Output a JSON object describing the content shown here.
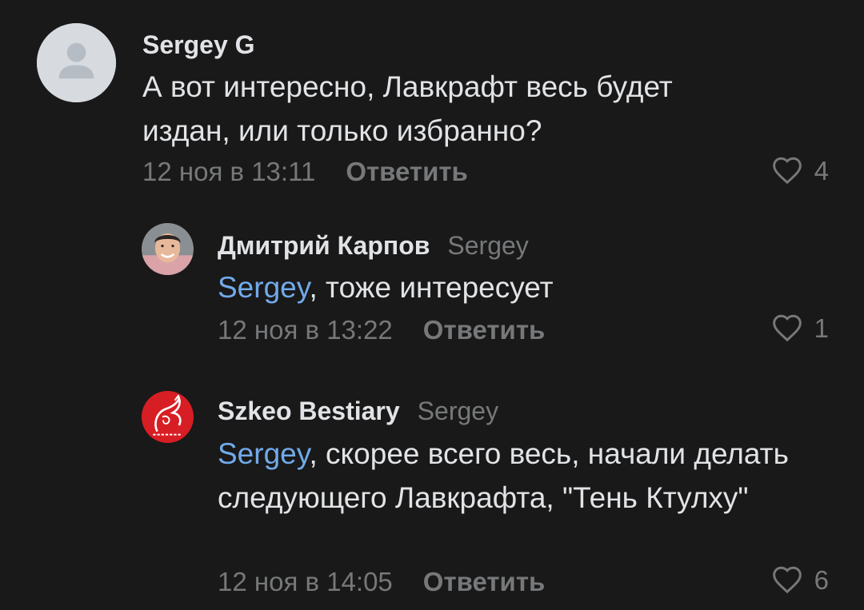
{
  "comments": [
    {
      "author": "Sergey G",
      "reply_to": "",
      "mention": "",
      "text": "А вот интересно, Лавкрафт весь будет издан, или только избранно?",
      "time": "12 ноя в 13:11",
      "reply_label": "Ответить",
      "likes": "4"
    },
    {
      "author": "Дмитрий Карпов",
      "reply_to": "Sergey",
      "mention": "Sergey",
      "text": ", тоже интересует",
      "time": "12 ноя в 13:22",
      "reply_label": "Ответить",
      "likes": "1"
    },
    {
      "author": "Szkeo Bestiary",
      "reply_to": "Sergey",
      "mention": "Sergey",
      "text": ", скорее всего весь, начали делать следующего Лавкрафта, \"Тень Ктулху\"",
      "time": "12 ноя в 14:05",
      "reply_label": "Ответить",
      "likes": "6"
    }
  ],
  "colors": {
    "background": "#191919",
    "text": "#e1e3e6",
    "secondary": "#76787a",
    "mention": "#71aaeb"
  },
  "icons": [
    "default-user-avatar-icon",
    "heart-icon"
  ]
}
